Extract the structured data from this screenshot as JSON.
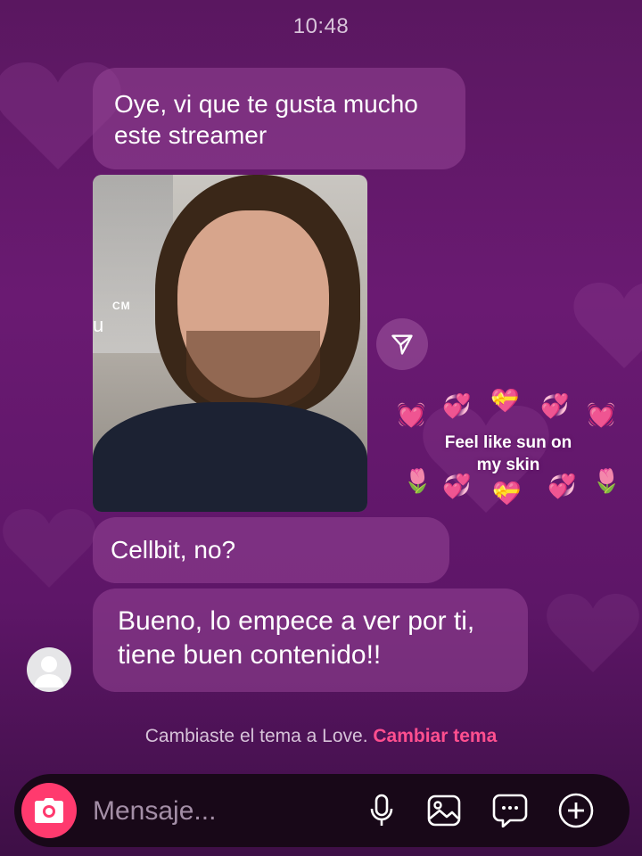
{
  "status": {
    "time": "10:48"
  },
  "theme": {
    "accent": "#ff3a6e",
    "link_color": "#ff4f8f",
    "bubble_color": "#8f4690",
    "name": "Love"
  },
  "messages": [
    {
      "text": "Oye, vi que te gusta mucho este streamer",
      "direction": "incoming"
    },
    {
      "text": "Cellbit, no?",
      "direction": "incoming"
    },
    {
      "text": "Bueno, lo empece a ver por ti, tiene buen contenido!!",
      "direction": "incoming"
    }
  ],
  "video_share": {
    "overlay_label": "CM",
    "overlay_char": "u",
    "sticker_caption_line1": "Feel like sun on",
    "sticker_caption_line2": "my skin",
    "share_icon": "paper-plane-icon"
  },
  "theme_note": {
    "text": "Cambiaste el tema a Love.",
    "action": "Cambiar tema"
  },
  "composer": {
    "placeholder": "Mensaje...",
    "icons": [
      "camera-icon",
      "microphone-icon",
      "gallery-icon",
      "sticker-chat-icon",
      "plus-icon"
    ]
  }
}
